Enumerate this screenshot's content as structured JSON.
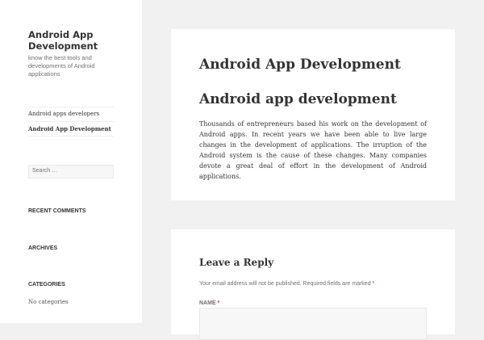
{
  "site": {
    "title": "Android App Development",
    "description": "know the best tools and developments of Android applications"
  },
  "menu": [
    {
      "label": "Android apps developers"
    },
    {
      "label": "Android App Development"
    }
  ],
  "search": {
    "placeholder": "Search …"
  },
  "widgets": {
    "recent_comments": "Recent Comments",
    "archives": "Archives",
    "categories": "Categories",
    "no_categories": "No categories"
  },
  "post": {
    "title": "Android App Development",
    "heading": "Android app development",
    "body": "Thousands of entrepreneurs based his work on the development of Android apps. In recent years we have been able to live large changes in the development of applications. The irruption of the Android system is the cause of these changes. Many companies devote a great deal of effort in the development of Android applications."
  },
  "reply": {
    "title": "Leave a Reply",
    "note": "Your email address will not be published. Required fields are marked",
    "required_mark": "*",
    "name_label": "Name"
  }
}
